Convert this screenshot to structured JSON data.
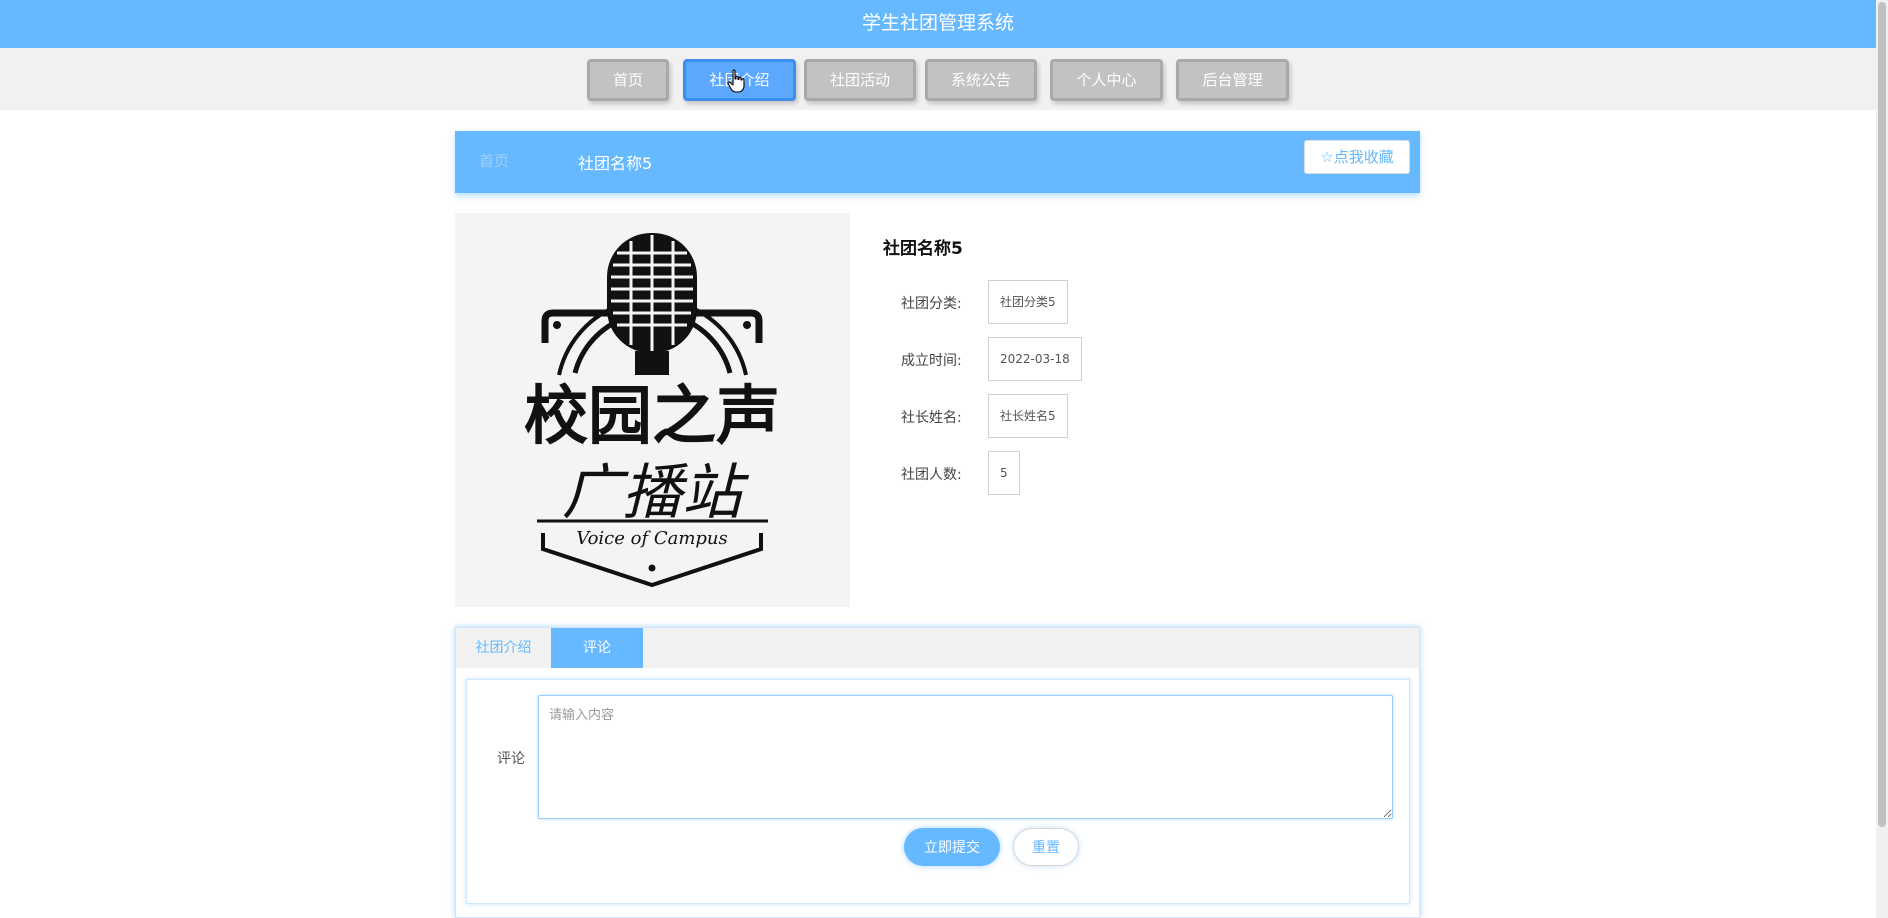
{
  "app": {
    "title": "学生社团管理系统"
  },
  "nav": {
    "items": [
      {
        "label": "首页"
      },
      {
        "label": "社团介绍"
      },
      {
        "label": "社团活动"
      },
      {
        "label": "系统公告"
      },
      {
        "label": "个人中心"
      },
      {
        "label": "后台管理"
      }
    ],
    "active": "社团介绍"
  },
  "breadcrumb": {
    "home": "首页",
    "current": "社团名称5"
  },
  "favorite": {
    "icon": "star-outline-icon",
    "label": "点我收藏"
  },
  "logo": {
    "alt": "campus-radio-logo",
    "text_main": "校园之声",
    "text_sub": "广播站",
    "text_en": "Voice of Campus"
  },
  "club": {
    "name": "社团名称5",
    "fields": [
      {
        "label": "社团分类:",
        "value": "社团分类5"
      },
      {
        "label": "成立时间:",
        "value": "2022-03-18"
      },
      {
        "label": "社长姓名:",
        "value": "社长姓名5"
      },
      {
        "label": "社团人数:",
        "value": "5"
      }
    ]
  },
  "tabs": [
    {
      "label": "社团介绍",
      "active": false
    },
    {
      "label": "评论",
      "active": true
    }
  ],
  "comment": {
    "label": "评论",
    "placeholder": "请输入内容",
    "value": "",
    "submit_label": "立即提交",
    "reset_label": "重置"
  },
  "colors": {
    "accent": "#66b8ff",
    "nav_button": "#c2c2c2",
    "nav_active": "#5da8ff"
  }
}
